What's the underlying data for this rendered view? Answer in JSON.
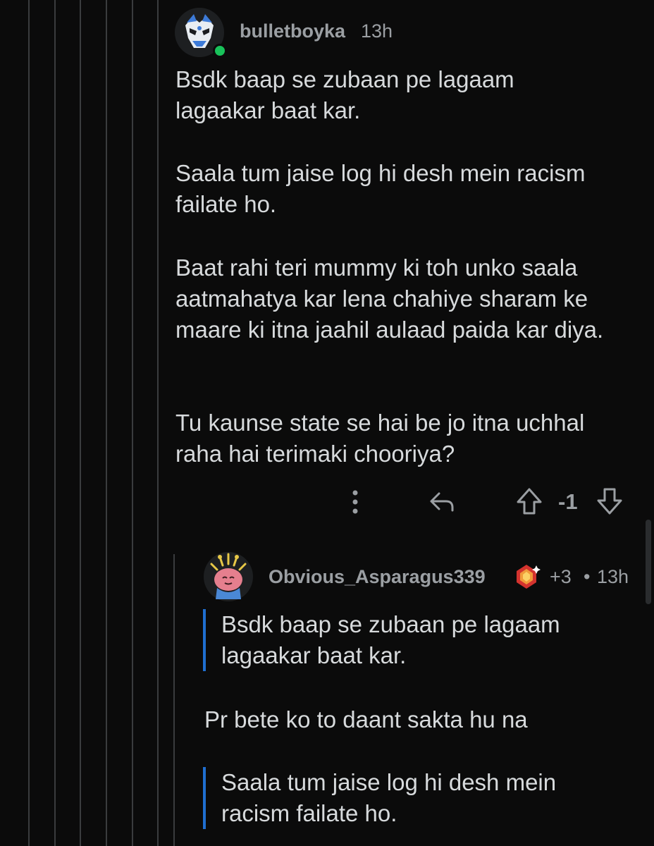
{
  "comment1": {
    "username": "bulletboyka",
    "time": "13h",
    "paragraphs": [
      "Bsdk baap se zubaan pe lagaam lagaakar baat kar.",
      "Saala tum jaise log hi desh mein racism failate ho.",
      "Baat rahi teri mummy ki toh unko saala aatmahatya kar lena chahiye sharam ke maare ki itna jaahil aulaad paida kar diya.",
      "Tu kaunse state se hai be jo itna uchhal raha hai terimaki chooriya?"
    ],
    "score": "-1",
    "icons": {
      "more": "more-vertical-icon",
      "reply": "reply-icon",
      "upvote": "upvote-icon",
      "downvote": "downvote-icon"
    }
  },
  "comment2": {
    "username": "Obvious_Asparagus339",
    "karma": "+3",
    "separator": "•",
    "time": "13h",
    "quote1": "Bsdk baap se zubaan pe lagaam lagaakar baat kar.",
    "paragraph1": "Pr bete ko to daant sakta hu na",
    "quote2": "Saala tum jaise log hi desh mein racism failate ho."
  },
  "colors": {
    "background": "#0b0b0b",
    "text": "#d7dadc",
    "meta": "#9b9fa3",
    "quote_bar": "#1f6fd1",
    "online": "#19c25a"
  }
}
